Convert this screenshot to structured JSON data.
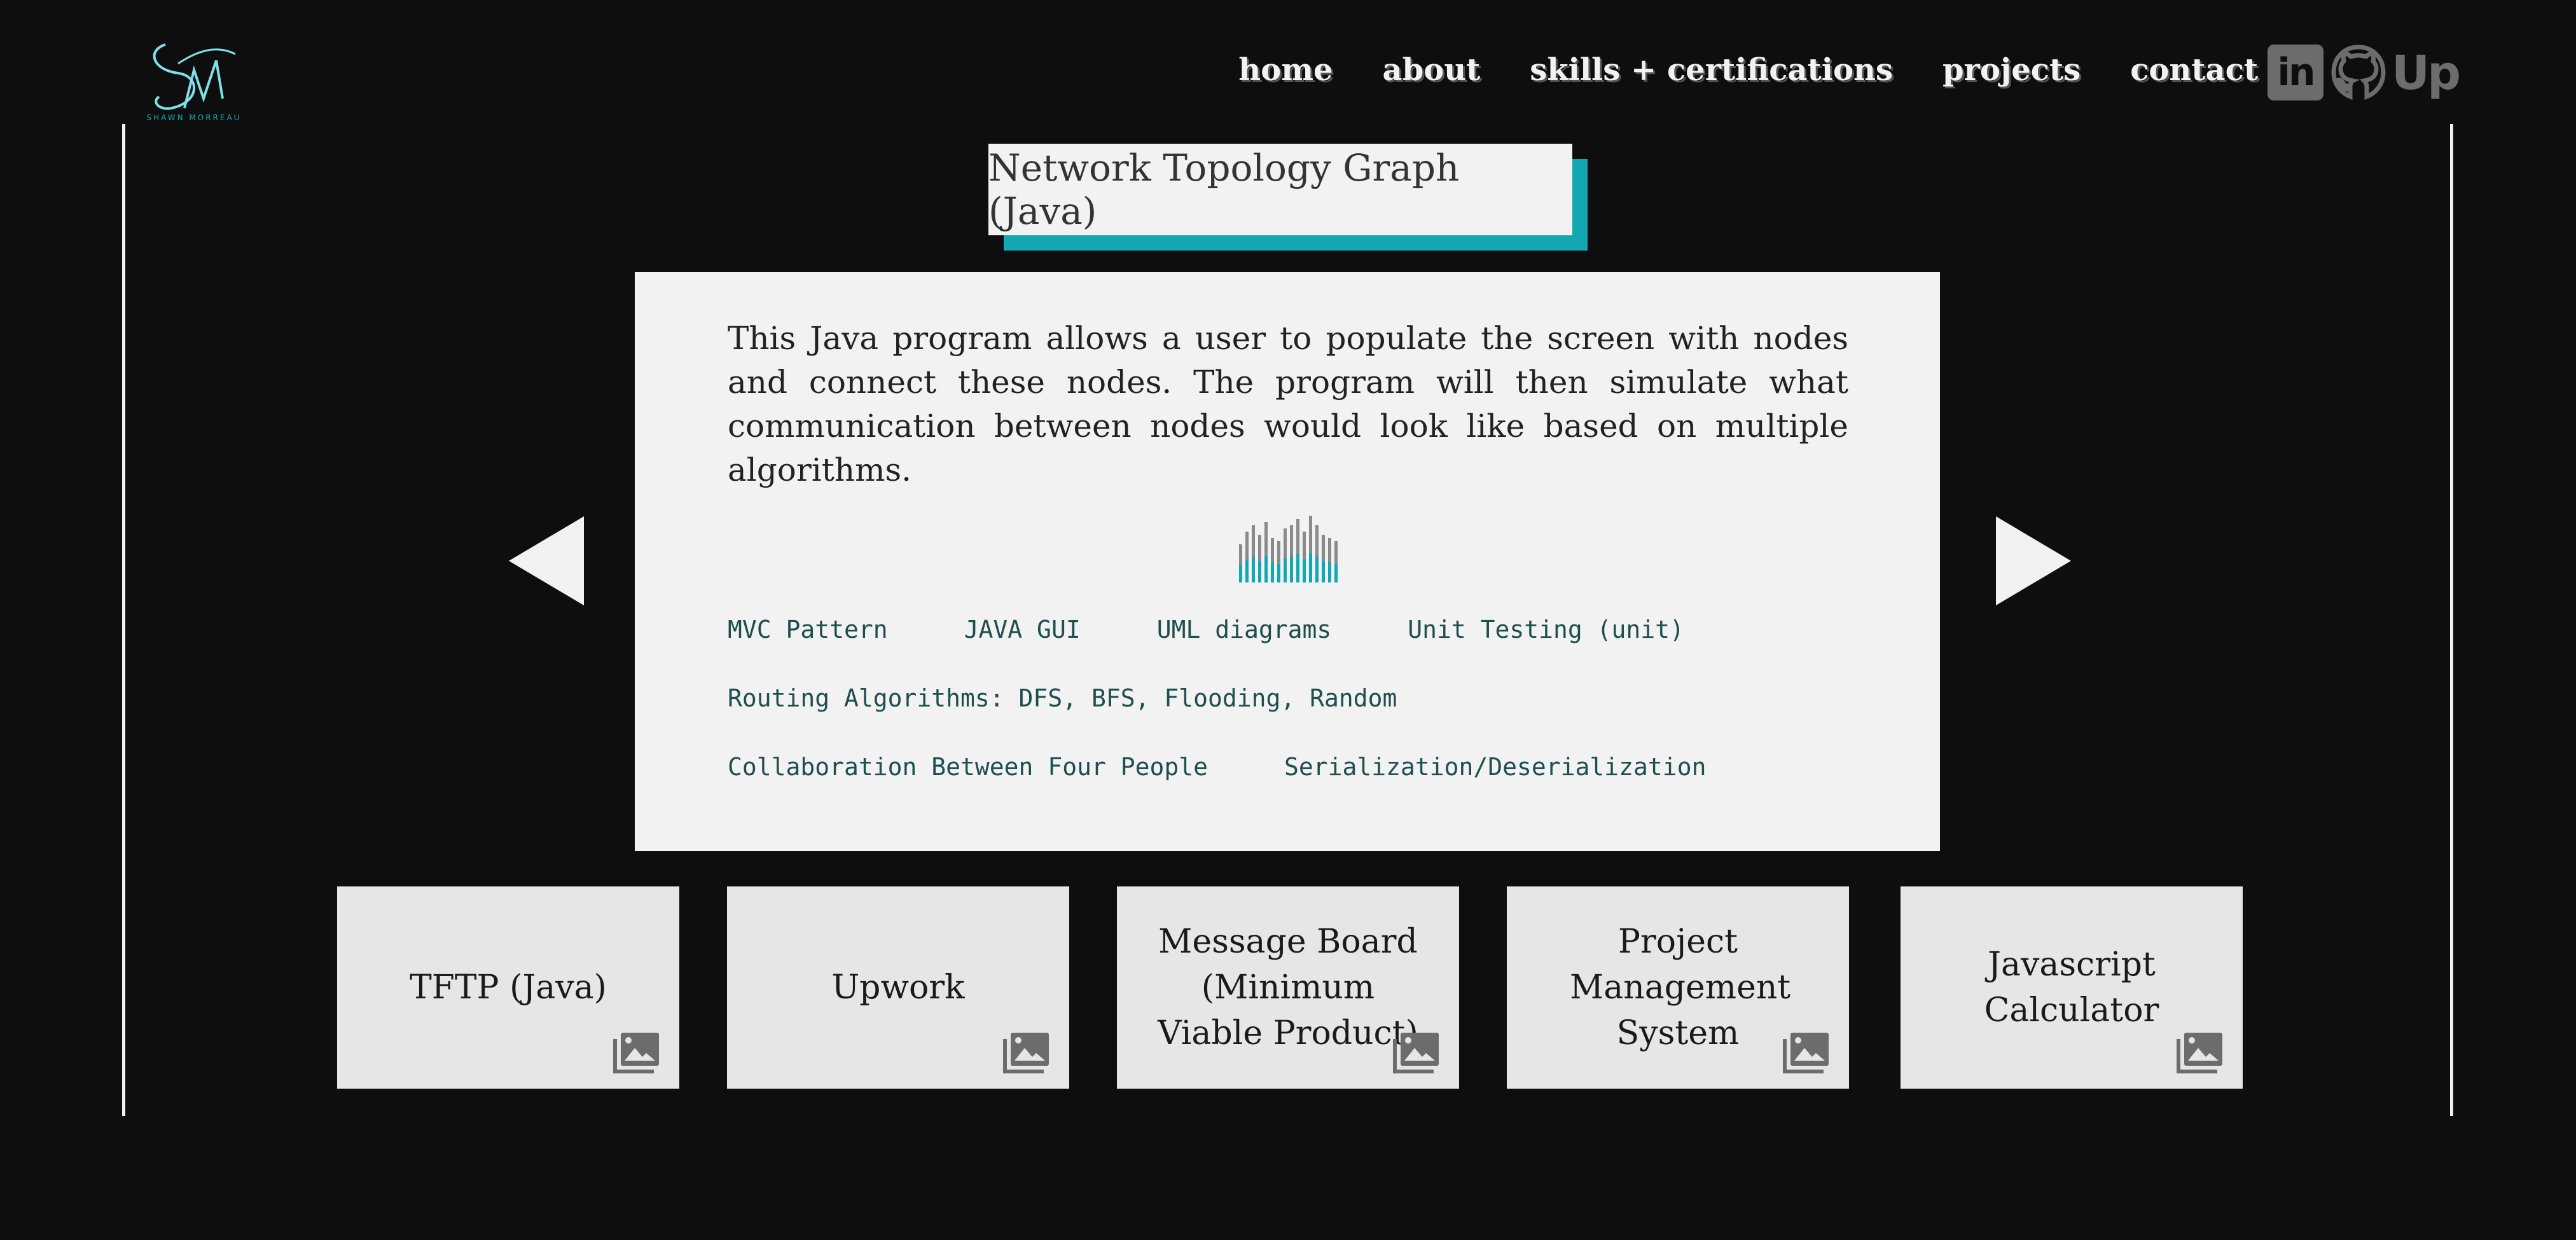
{
  "logo": {
    "subtitle": "SHAWN MORREAU"
  },
  "nav": {
    "items": [
      "home",
      "about",
      "skills + certifications",
      "projects",
      "contact"
    ]
  },
  "social": {
    "linkedin": "in",
    "github": "github-icon",
    "upwork": "Up"
  },
  "project": {
    "title": "Network Topology Graph (Java)",
    "description": "This Java program allows a user to populate the screen with nodes and connect these nodes. The program will then simulate what communication between nodes would look like based on multiple algorithms.",
    "tag_rows": [
      [
        "MVC Pattern",
        "JAVA GUI",
        "UML diagrams",
        "Unit Testing (unit)"
      ],
      [
        "Routing Algorithms: DFS, BFS, Flooding, Random"
      ],
      [
        "Collaboration Between Four People",
        "Serialization/Deserialization"
      ]
    ]
  },
  "thumbnails": [
    "TFTP (Java)",
    "Upwork",
    "Message Board (Minimum Viable Product)",
    "Project Management System",
    "Javascript Calculator"
  ],
  "colors": {
    "accent": "#13a7b3",
    "background": "#0e0e0e",
    "card": "#f2f2f2"
  }
}
